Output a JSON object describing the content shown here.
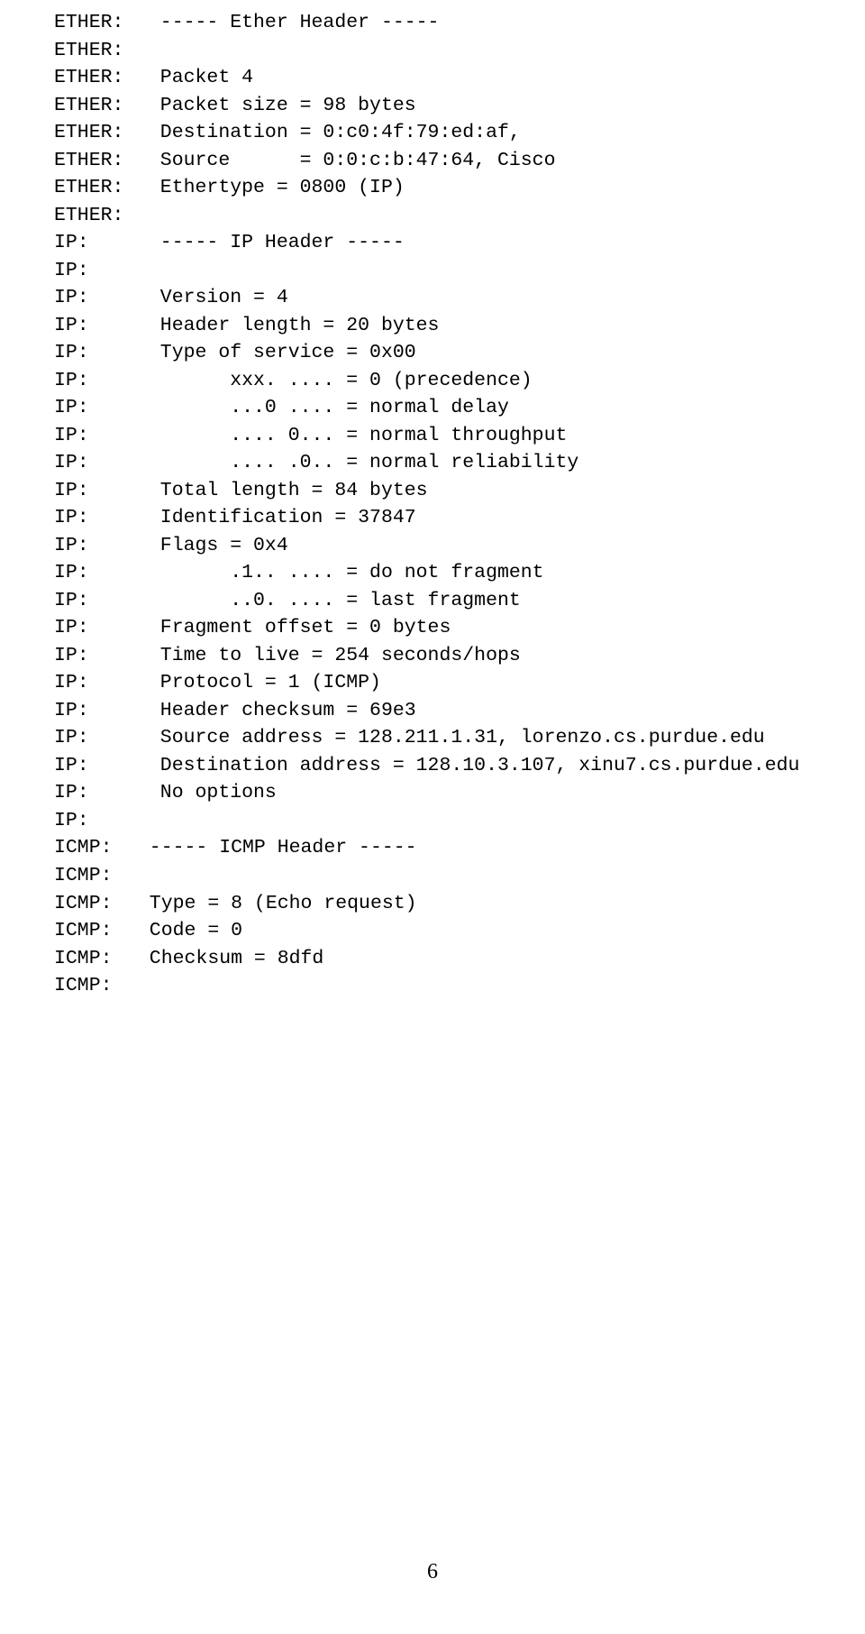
{
  "page_number": "6",
  "lines": [
    {
      "label": "ETHER:",
      "value": "  ----- Ether Header -----"
    },
    {
      "label": "ETHER:",
      "value": ""
    },
    {
      "label": "ETHER:",
      "value": "  Packet 4"
    },
    {
      "label": "ETHER:",
      "value": "  Packet size = 98 bytes"
    },
    {
      "label": "ETHER:",
      "value": "  Destination = 0:c0:4f:79:ed:af,"
    },
    {
      "label": "ETHER:",
      "value": "  Source      = 0:0:c:b:47:64, Cisco"
    },
    {
      "label": "ETHER:",
      "value": "  Ethertype = 0800 (IP)"
    },
    {
      "label": "ETHER:",
      "value": ""
    },
    {
      "label": "IP:",
      "value": "  ----- IP Header -----"
    },
    {
      "label": "IP:",
      "value": ""
    },
    {
      "label": "IP:",
      "value": "  Version = 4"
    },
    {
      "label": "IP:",
      "value": "  Header length = 20 bytes"
    },
    {
      "label": "IP:",
      "value": "  Type of service = 0x00"
    },
    {
      "label": "IP:",
      "value": "        xxx. .... = 0 (precedence)"
    },
    {
      "label": "IP:",
      "value": "        ...0 .... = normal delay"
    },
    {
      "label": "IP:",
      "value": "        .... 0... = normal throughput"
    },
    {
      "label": "IP:",
      "value": "        .... .0.. = normal reliability"
    },
    {
      "label": "IP:",
      "value": "  Total length = 84 bytes"
    },
    {
      "label": "IP:",
      "value": "  Identification = 37847"
    },
    {
      "label": "IP:",
      "value": "  Flags = 0x4"
    },
    {
      "label": "IP:",
      "value": "        .1.. .... = do not fragment"
    },
    {
      "label": "IP:",
      "value": "        ..0. .... = last fragment"
    },
    {
      "label": "IP:",
      "value": "  Fragment offset = 0 bytes"
    },
    {
      "label": "IP:",
      "value": "  Time to live = 254 seconds/hops"
    },
    {
      "label": "IP:",
      "value": "  Protocol = 1 (ICMP)"
    },
    {
      "label": "IP:",
      "value": "  Header checksum = 69e3"
    },
    {
      "label": "IP:",
      "value": "  Source address = 128.211.1.31, lorenzo.cs.purdue.edu"
    },
    {
      "label": "IP:",
      "value": "  Destination address = 128.10.3.107, xinu7.cs.purdue.edu"
    },
    {
      "label": "IP:",
      "value": "  No options"
    },
    {
      "label": "IP:",
      "value": ""
    },
    {
      "label": "ICMP:",
      "value": "  ----- ICMP Header -----"
    },
    {
      "label": "ICMP:",
      "value": ""
    },
    {
      "label": "ICMP:",
      "value": "  Type = 8 (Echo request)"
    },
    {
      "label": "ICMP:",
      "value": "  Code = 0"
    },
    {
      "label": "ICMP:",
      "value": "  Checksum = 8dfd"
    },
    {
      "label": "ICMP:",
      "value": ""
    }
  ]
}
